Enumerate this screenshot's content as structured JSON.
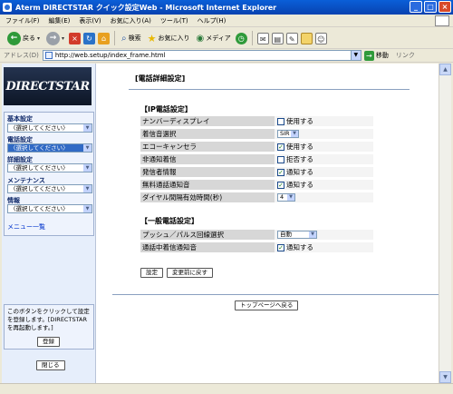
{
  "window": {
    "title": "Aterm DIRECTSTAR クイック設定Web - Microsoft Internet Explorer"
  },
  "menu": [
    "ファイル(F)",
    "編集(E)",
    "表示(V)",
    "お気に入り(A)",
    "ツール(T)",
    "ヘルプ(H)"
  ],
  "toolbar": {
    "back": "戻る",
    "search": "検索",
    "favorites": "お気に入り",
    "media": "メディア"
  },
  "address": {
    "label": "アドレス(D)",
    "url": "http://web.setup/index_frame.html",
    "go": "移動",
    "links": "リンク"
  },
  "sidebar": {
    "logo": "DIRECTSTAR",
    "groups": [
      {
        "label": "基本設定",
        "value": "〈選択してください〉",
        "selected": false
      },
      {
        "label": "電話設定",
        "value": "〈選択してください〉",
        "selected": true
      },
      {
        "label": "詳細設定",
        "value": "〈選択してください〉",
        "selected": false
      },
      {
        "label": "メンテナンス",
        "value": "〈選択してください〉",
        "selected": false
      },
      {
        "label": "情報",
        "value": "〈選択してください〉",
        "selected": false
      }
    ],
    "menu_list": "メニュー一覧",
    "info_text": "このボタンをクリックして設定を登録します。[DIRECTSTARを再起動します。]",
    "register_button": "登録",
    "close_button": "閉じる"
  },
  "main": {
    "page_title": "[電話詳細設定]",
    "ip_section": {
      "title": "【IP電話設定】",
      "rows": [
        {
          "label": "ナンバーディスプレイ",
          "type": "checkbox",
          "checked": false,
          "text": "使用する"
        },
        {
          "label": "着信音選択",
          "type": "select",
          "value": "SIR"
        },
        {
          "label": "エコーキャンセラ",
          "type": "checkbox",
          "checked": true,
          "text": "使用する"
        },
        {
          "label": "非通知着信",
          "type": "checkbox",
          "checked": false,
          "text": "拒否する"
        },
        {
          "label": "発信者情報",
          "type": "checkbox",
          "checked": true,
          "text": "通知する"
        },
        {
          "label": "無料通話通知音",
          "type": "checkbox",
          "checked": true,
          "text": "通知する"
        },
        {
          "label": "ダイヤル間隔有効時間(秒)",
          "type": "select",
          "value": "4"
        }
      ]
    },
    "general_section": {
      "title": "【一般電話設定】",
      "rows": [
        {
          "label": "プッシュ／パルス回線選択",
          "type": "select",
          "value": "自動"
        },
        {
          "label": "通話中着信通知音",
          "type": "checkbox",
          "checked": true,
          "text": "通知する"
        }
      ]
    },
    "buttons": {
      "apply": "設定",
      "reset": "変更前に戻す"
    },
    "top_page_button": "トップページへ戻る"
  }
}
